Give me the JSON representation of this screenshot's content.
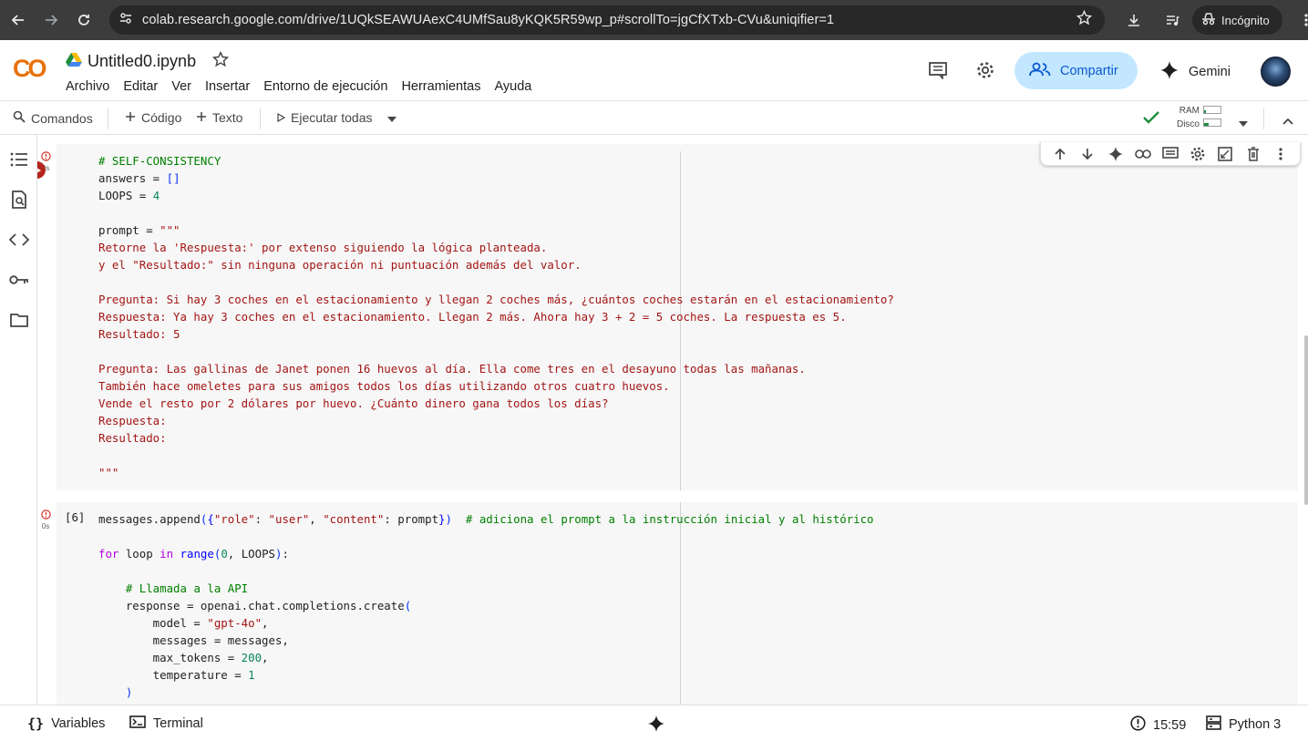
{
  "browser": {
    "url": "colab.research.google.com/drive/1UQkSEAWUAexC4UMfSau8yKQK5R59wp_p#scrollTo=jgCfXTxb-CVu&uniqifier=1",
    "incognito_label": "Incógnito"
  },
  "header": {
    "logo": "CO",
    "file_name": "Untitled0.ipynb",
    "menu": [
      "Archivo",
      "Editar",
      "Ver",
      "Insertar",
      "Entorno de ejecución",
      "Herramientas",
      "Ayuda"
    ],
    "share_label": "Compartir",
    "gemini_label": "Gemini"
  },
  "toolbar": {
    "commands_label": "Comandos",
    "code_label": "Código",
    "text_label": "Texto",
    "run_all_label": "Ejecutar todas",
    "ram_label": "RAM",
    "disk_label": "Disco",
    "ram_usage": 0.1,
    "disk_usage": 0.3
  },
  "cells": [
    {
      "exec_time": "0s",
      "lines": [
        [
          [
            "c-comment",
            "# SELF-CONSISTENCY"
          ]
        ],
        [
          [
            "",
            "answers = "
          ],
          [
            "c-br",
            "[]"
          ]
        ],
        [
          [
            "",
            "LOOPS = "
          ],
          [
            "c-num",
            "4"
          ]
        ],
        [
          [
            "",
            ""
          ]
        ],
        [
          [
            "",
            "prompt = "
          ],
          [
            "c-str",
            "\"\"\""
          ]
        ],
        [
          [
            "c-str",
            "Retorne la 'Respuesta:' por extenso siguiendo la lógica planteada."
          ]
        ],
        [
          [
            "c-str",
            "y el \"Resultado:\" sin ninguna operación ni puntuación además del valor."
          ]
        ],
        [
          [
            "",
            ""
          ]
        ],
        [
          [
            "c-str",
            "Pregunta: Si hay 3 coches en el estacionamiento y llegan 2 coches más, ¿cuántos coches estarán en el estacionamiento?"
          ]
        ],
        [
          [
            "c-str",
            "Respuesta: Ya hay 3 coches en el estacionamiento. Llegan 2 más. Ahora hay 3 + 2 = 5 coches. La respuesta es 5."
          ]
        ],
        [
          [
            "c-str",
            "Resultado: 5"
          ]
        ],
        [
          [
            "",
            ""
          ]
        ],
        [
          [
            "c-str",
            "Pregunta: Las gallinas de Janet ponen 16 huevos al día. Ella come tres en el desayuno todas las mañanas."
          ]
        ],
        [
          [
            "c-str",
            "También hace omeletes para sus amigos todos los días utilizando otros cuatro huevos."
          ]
        ],
        [
          [
            "c-str",
            "Vende el resto por 2 dólares por huevo. ¿Cuánto dinero gana todos los días?"
          ]
        ],
        [
          [
            "c-str",
            "Respuesta:"
          ]
        ],
        [
          [
            "c-str",
            "Resultado:"
          ]
        ],
        [
          [
            "",
            ""
          ]
        ],
        [
          [
            "c-str",
            "\"\"\""
          ]
        ]
      ]
    },
    {
      "exec_count": "[6]",
      "exec_time": "0s",
      "lines": [
        [
          [
            "",
            "messages.append"
          ],
          [
            "c-br",
            "("
          ],
          [
            "c-kw",
            "{"
          ],
          [
            "c-str",
            "\"role\""
          ],
          [
            "",
            ": "
          ],
          [
            "c-str",
            "\"user\""
          ],
          [
            "",
            ", "
          ],
          [
            "c-str",
            "\"content\""
          ],
          [
            "",
            ": prompt"
          ],
          [
            "c-kw",
            "}"
          ],
          [
            "c-br",
            ")"
          ],
          [
            "",
            "  "
          ],
          [
            "c-comment",
            "# adiciona el prompt a la instrucción inicial y al histórico"
          ]
        ],
        [
          [
            "",
            ""
          ]
        ],
        [
          [
            "c-kw2",
            "for"
          ],
          [
            "",
            " loop "
          ],
          [
            "c-kw2",
            "in"
          ],
          [
            "",
            " "
          ],
          [
            "c-kw",
            "range"
          ],
          [
            "c-br",
            "("
          ],
          [
            "c-num",
            "0"
          ],
          [
            "",
            ", LOOPS"
          ],
          [
            "c-br",
            ")"
          ],
          [
            "",
            ":"
          ]
        ],
        [
          [
            "",
            ""
          ]
        ],
        [
          [
            "",
            "    "
          ],
          [
            "c-comment",
            "# Llamada a la API"
          ]
        ],
        [
          [
            "",
            "    response = openai.chat.completions.create"
          ],
          [
            "c-br",
            "("
          ]
        ],
        [
          [
            "",
            "        model = "
          ],
          [
            "c-str",
            "\"gpt-4o\""
          ],
          [
            "",
            ","
          ]
        ],
        [
          [
            "",
            "        messages = messages,"
          ]
        ],
        [
          [
            "",
            "        max_tokens = "
          ],
          [
            "c-num",
            "200"
          ],
          [
            "",
            ","
          ]
        ],
        [
          [
            "",
            "        temperature = "
          ],
          [
            "c-num",
            "1"
          ]
        ],
        [
          [
            "",
            "    "
          ],
          [
            "c-br",
            ")"
          ]
        ]
      ]
    }
  ],
  "status": {
    "variables_label": "Variables",
    "terminal_label": "Terminal",
    "time": "15:59",
    "runtime_label": "Python 3"
  },
  "icons": [
    "back-icon",
    "forward-icon",
    "reload-icon",
    "site-info-icon",
    "bookmark-star-icon",
    "download-icon",
    "media-icon",
    "incognito-icon",
    "more-icon",
    "drive-icon",
    "star-icon",
    "comment-icon",
    "settings-icon",
    "people-icon",
    "gemini-icon",
    "search-icon",
    "plus-icon",
    "play-icon",
    "check-icon",
    "toc-icon",
    "find-icon",
    "code-icon",
    "key-icon",
    "folder-icon",
    "error-icon",
    "run-icon",
    "arrow-up-icon",
    "arrow-down-icon",
    "sparkle-icon",
    "link-icon",
    "comment-cell-icon",
    "gear-cell-icon",
    "mirror-icon",
    "delete-icon",
    "braces-icon",
    "terminal-icon",
    "python-icon"
  ]
}
